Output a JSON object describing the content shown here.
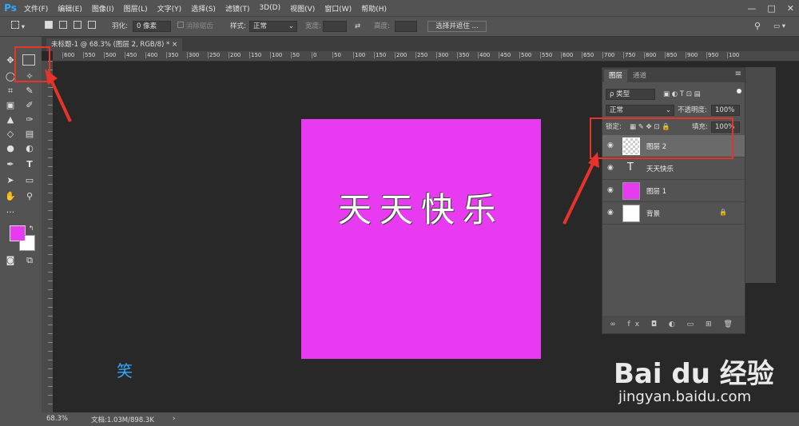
{
  "menubar": {
    "logo": "Ps",
    "items": [
      "文件(F)",
      "编辑(E)",
      "图像(I)",
      "图层(L)",
      "文字(Y)",
      "选择(S)",
      "滤镜(T)",
      "3D(D)",
      "视图(V)",
      "窗口(W)",
      "帮助(H)"
    ],
    "minimize": "—",
    "restore": "□",
    "close": "✕"
  },
  "options": {
    "feather_label": "羽化:",
    "feather_value": "0 像素",
    "antialias": "消除锯齿",
    "style_label": "样式:",
    "style_value": "正常",
    "width_label": "宽度:",
    "height_label": "高度:",
    "select_mask": "选择并遮住 ..."
  },
  "document": {
    "tab_title": "未标题-1 @ 68.3% (图层 2, RGB/8) *",
    "close": "×",
    "canvas_text": "天天快乐"
  },
  "ruler": {
    "h_ticks": [
      "600",
      "550",
      "500",
      "450",
      "400",
      "350",
      "300",
      "250",
      "200",
      "150",
      "100",
      "50",
      "0",
      "50",
      "100",
      "150",
      "200",
      "250",
      "300",
      "350",
      "400",
      "450",
      "500",
      "550",
      "600",
      "650",
      "700",
      "750",
      "800",
      "850",
      "900",
      "950",
      "100"
    ]
  },
  "status": {
    "zoom": "68.3%",
    "doc_info": "文档:1.03M/898.3K",
    "arrow": "›"
  },
  "layers": {
    "tab_layers": "图层",
    "tab_channels": "通道",
    "filter_kind": "ρ 类型",
    "blend_mode": "正常",
    "opacity_label": "不透明度:",
    "opacity_value": "100%",
    "lock_label": "锁定:",
    "fill_label": "填充:",
    "fill_value": "100%",
    "rows": [
      {
        "name": "图层 2",
        "selected": true
      },
      {
        "name": "天天快乐",
        "type": "text"
      },
      {
        "name": "图层 1",
        "color": "#e83af0"
      },
      {
        "name": "背景",
        "locked": true
      }
    ]
  },
  "colors": {
    "foreground": "#e83af0",
    "background": "#ffffff",
    "accent": "#31a8ff",
    "annotation": "#e8332a"
  },
  "watermark": {
    "brand": "Bai du 经验",
    "url": "jingyan.baidu.com",
    "small_char": "笑"
  }
}
